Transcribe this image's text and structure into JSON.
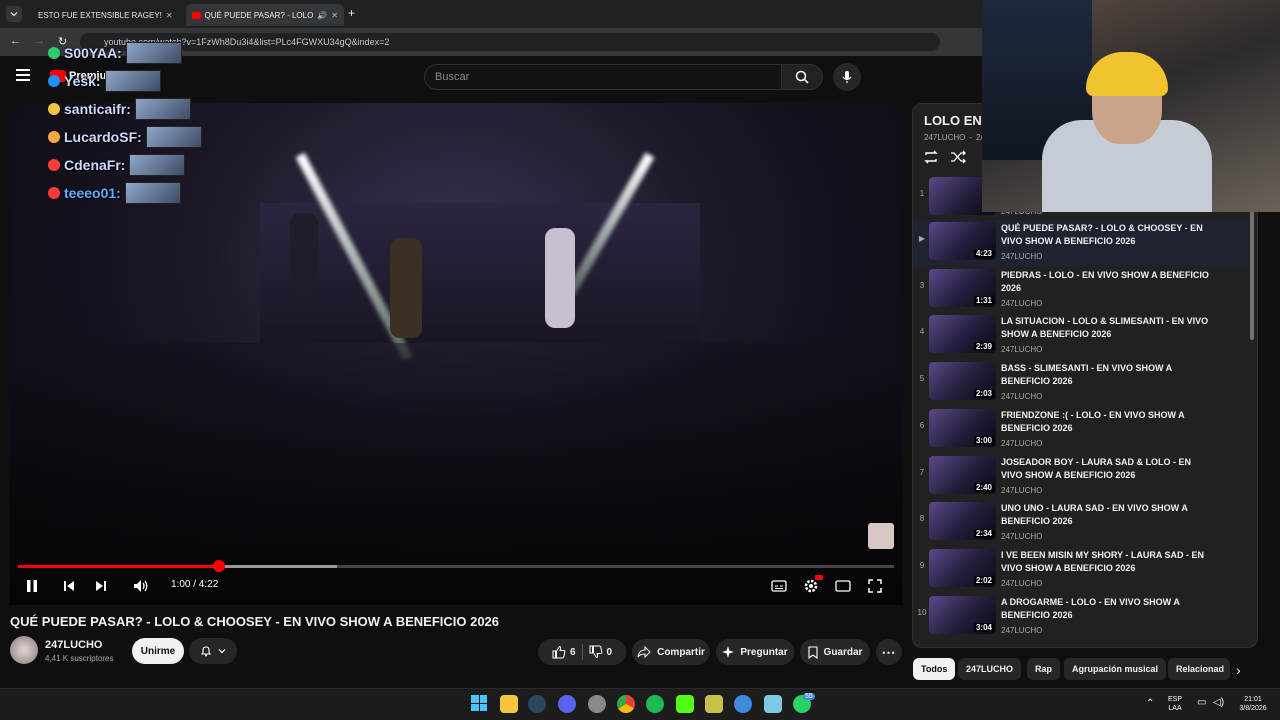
{
  "browser": {
    "tabs": [
      {
        "title": "ESTO FUE EXTENSIBLE RAGEY!"
      },
      {
        "title": "QUÉ PUEDE PASAR? - LOLO"
      }
    ],
    "url": "youtube.com/watch?v=1FzWh8Du3i4&list=PLc4FGWXU34gQ&index=2"
  },
  "header": {
    "logo_text": "Premium",
    "search_placeholder": "Buscar"
  },
  "chat": [
    {
      "user": "S00YAA:"
    },
    {
      "user": "Yesk:"
    },
    {
      "user": "santicaifr:"
    },
    {
      "user": "LucardoSF:"
    },
    {
      "user": "CdenaFr:"
    },
    {
      "user": "teeeo01:"
    }
  ],
  "player": {
    "time": "1:00 / 4:22",
    "progress": 0.229,
    "buffered": 0.364
  },
  "video": {
    "title": "QUÉ PUEDE PASAR? - LOLO & CHOOSEY - EN VIVO SHOW A BENEFICIO 2026",
    "channel": "247LUCHO",
    "subscribers": "4,41 K suscriptores",
    "join_label": "Unirme",
    "likes": "6",
    "dislikes": "0",
    "share_label": "Compartir",
    "ask_label": "Preguntar",
    "save_label": "Guardar"
  },
  "playlist": {
    "title": "LOLO EN V",
    "owner": "247LUCHO",
    "position": "2/2",
    "first_item_author": "247LUCHO",
    "first_item_index": "1",
    "items": [
      {
        "index": "▶",
        "title": "QUÉ PUEDE PASAR? - LOLO & CHOOSEY - EN VIVO SHOW A BENEFICIO 2026",
        "author": "247LUCHO",
        "duration": "4:23"
      },
      {
        "index": "3",
        "title": "PIEDRAS - LOLO - EN VIVO SHOW A BENEFICIO 2026",
        "author": "247LUCHO",
        "duration": "1:31"
      },
      {
        "index": "4",
        "title": "LA SITUACION - LOLO & SLIMESANTI - EN VIVO SHOW A BENEFICIO 2026",
        "author": "247LUCHO",
        "duration": "2:39"
      },
      {
        "index": "5",
        "title": "BASS - SLIMESANTI - EN VIVO SHOW A BENEFICIO 2026",
        "author": "247LUCHO",
        "duration": "2:03"
      },
      {
        "index": "6",
        "title": "FRIENDZONE :( - LOLO - EN VIVO SHOW A BENEFICIO 2026",
        "author": "247LUCHO",
        "duration": "3:00"
      },
      {
        "index": "7",
        "title": "JOSEADOR BOY - LAURA SAD & LOLO - EN VIVO SHOW A BENEFICIO 2026",
        "author": "247LUCHO",
        "duration": "2:40"
      },
      {
        "index": "8",
        "title": "UNO UNO - LAURA SAD - EN VIVO SHOW A BENEFICIO 2026",
        "author": "247LUCHO",
        "duration": "2:34"
      },
      {
        "index": "9",
        "title": "I VE BEEN MISIN MY SHORY - LAURA SAD - EN VIVO SHOW A BENEFICIO 2026",
        "author": "247LUCHO",
        "duration": "2:02"
      },
      {
        "index": "10",
        "title": "A DROGARME - LOLO - EN VIVO SHOW A BENEFICIO 2026",
        "author": "247LUCHO",
        "duration": "3:04"
      }
    ]
  },
  "chips": [
    "Todos",
    "247LUCHO",
    "Rap",
    "Agrupación musical",
    "Relacionad"
  ],
  "taskbar": {
    "lang_top": "ESP",
    "lang_bottom": "LAA",
    "time": "21:01",
    "date": "3/8/2026",
    "whatsapp_badge": "55"
  },
  "colors": {
    "accent": "#ff0000",
    "background": "#0f0f0f",
    "panel": "#212121"
  }
}
